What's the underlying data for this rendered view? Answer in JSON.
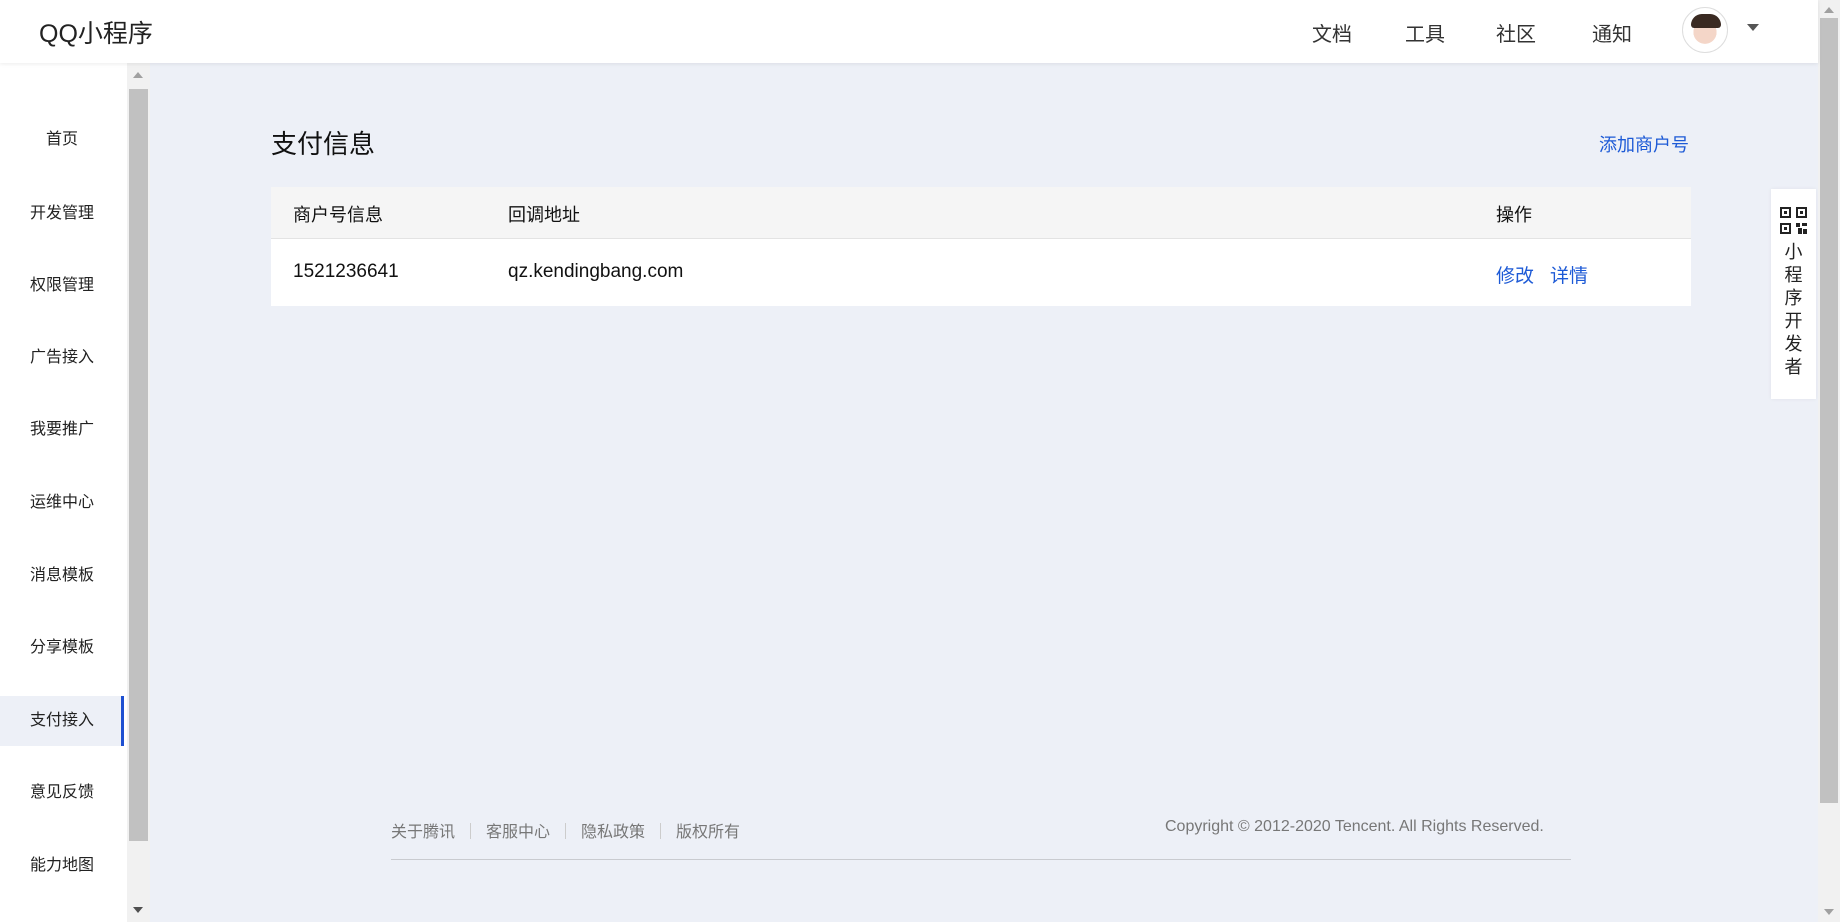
{
  "header": {
    "brand": "QQ小程序",
    "nav": [
      "文档",
      "工具",
      "社区",
      "通知"
    ]
  },
  "sidebar": {
    "items": [
      {
        "label": "首页"
      },
      {
        "label": "开发管理"
      },
      {
        "label": "权限管理"
      },
      {
        "label": "广告接入"
      },
      {
        "label": "我要推广"
      },
      {
        "label": "运维中心"
      },
      {
        "label": "消息模板"
      },
      {
        "label": "分享模板"
      },
      {
        "label": "支付接入",
        "active": true
      },
      {
        "label": "意见反馈"
      },
      {
        "label": "能力地图"
      }
    ]
  },
  "main": {
    "title": "支付信息",
    "add_link": "添加商户号",
    "table": {
      "headers": [
        "商户号信息",
        "回调地址",
        "操作"
      ],
      "rows": [
        {
          "merchant_id": "1521236641",
          "callback": "qz.kendingbang.com",
          "actions": [
            "修改",
            "详情"
          ]
        }
      ]
    }
  },
  "footer": {
    "links": [
      "关于腾讯",
      "客服中心",
      "隐私政策",
      "版权所有"
    ],
    "copyright": "Copyright © 2012-2020 Tencent. All Rights Reserved."
  },
  "dev_widget": {
    "chars": [
      "小",
      "程",
      "序",
      "开",
      "发",
      "者"
    ],
    "icon": "qr-code-icon"
  },
  "colors": {
    "accent": "#1d5ad6",
    "page_bg": "#edf0f7",
    "active_indicator": "#1d4fd1"
  }
}
